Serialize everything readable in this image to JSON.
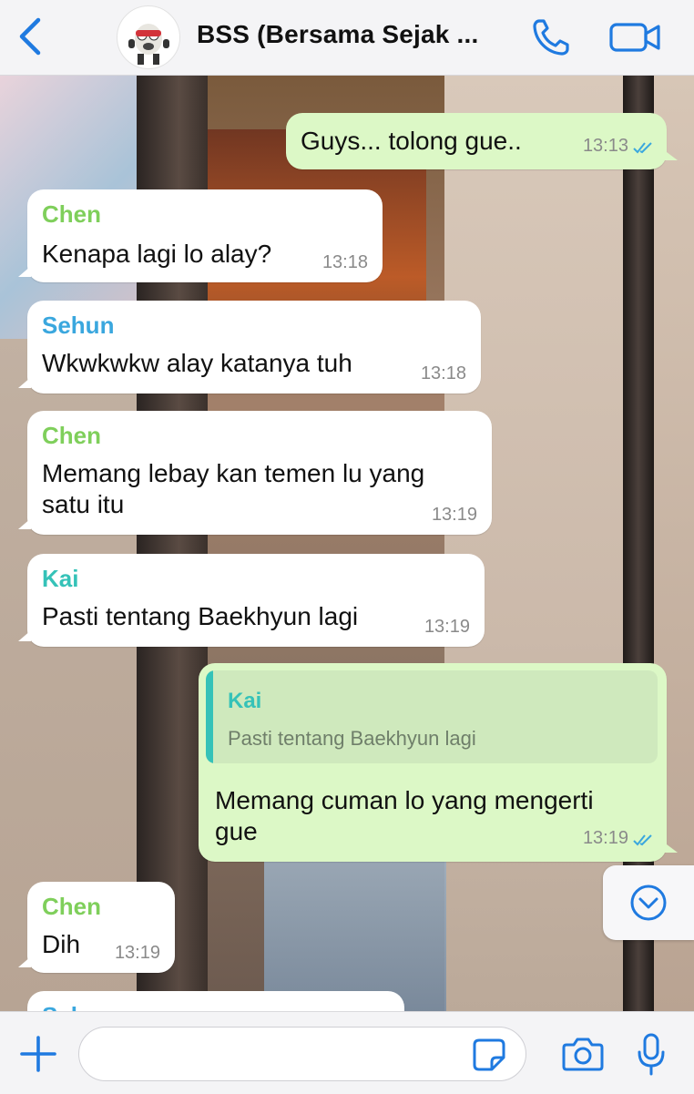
{
  "header": {
    "title": "BSS (Bersama Sejak ...",
    "accent": "#1f7ae0"
  },
  "messages": [
    {
      "direction": "out",
      "text": "Guys... tolong gue..",
      "time": "13:13",
      "status": "read"
    },
    {
      "direction": "in",
      "sender": "Chen",
      "sender_color": "#7fcf5b",
      "text": "Kenapa lagi lo alay?",
      "time": "13:18"
    },
    {
      "direction": "in",
      "sender": "Sehun",
      "sender_color": "#3aa7de",
      "text": "Wkwkwkw alay katanya tuh",
      "time": "13:18"
    },
    {
      "direction": "in",
      "sender": "Chen",
      "sender_color": "#7fcf5b",
      "text_line1": "Memang lebay kan temen lu yang",
      "text_line2": "satu itu",
      "time": "13:19"
    },
    {
      "direction": "in",
      "sender": "Kai",
      "sender_color": "#35c2b8",
      "text": "Pasti tentang Baekhyun lagi",
      "time": "13:19"
    },
    {
      "direction": "out",
      "quote_sender": "Kai",
      "quote_text": "Pasti tentang Baekhyun lagi",
      "text_line1": "Memang cuman lo yang mengerti",
      "text_line2": "gue",
      "time": "13:19",
      "status": "read"
    },
    {
      "direction": "in",
      "sender": "Chen",
      "sender_color": "#7fcf5b",
      "text": "Dih",
      "time": "13:19"
    },
    {
      "direction": "in",
      "sender": "Sehun",
      "sender_color": "#3aa7de",
      "partial": true
    }
  ],
  "composer": {
    "placeholder": ""
  },
  "icons": [
    "back-icon",
    "group-avatar",
    "call-icon",
    "video-icon",
    "scroll-down-icon",
    "plus-icon",
    "sticker-icon",
    "camera-icon",
    "mic-icon"
  ]
}
